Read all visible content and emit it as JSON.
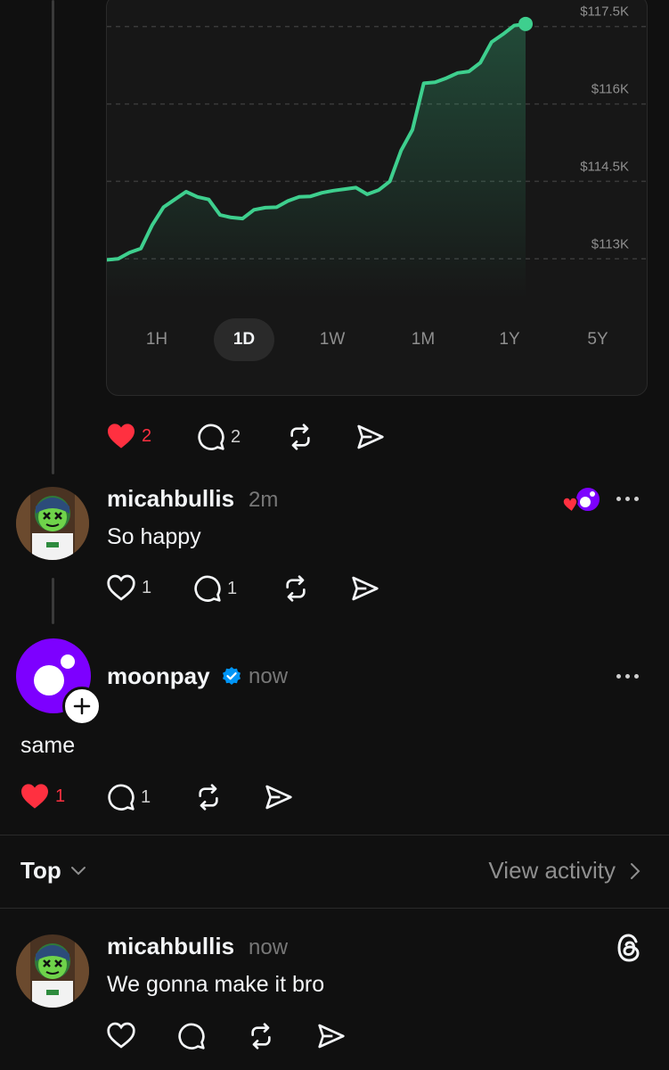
{
  "chart_data": {
    "type": "area",
    "y_ticks": [
      "$117.5K",
      "$116K",
      "$114.5K",
      "$113K"
    ],
    "y_tick_values": [
      117500,
      116000,
      114500,
      113000
    ],
    "ylim": [
      112400,
      118100
    ],
    "grid": true,
    "series_color": "#3ecf8e",
    "values": [
      112980,
      113000,
      113120,
      113200,
      113650,
      114000,
      114150,
      114300,
      114200,
      114150,
      113850,
      113800,
      113780,
      113950,
      113990,
      114000,
      114120,
      114200,
      114210,
      114280,
      114320,
      114350,
      114380,
      114250,
      114330,
      114500,
      115100,
      115500,
      116400,
      116420,
      116500,
      116600,
      116630,
      116800,
      117200,
      117350,
      117520,
      117550
    ]
  },
  "ranges": [
    {
      "label": "1H",
      "active": false
    },
    {
      "label": "1D",
      "active": true
    },
    {
      "label": "1W",
      "active": false
    },
    {
      "label": "1M",
      "active": false
    },
    {
      "label": "1Y",
      "active": false
    },
    {
      "label": "5Y",
      "active": false
    }
  ],
  "post_main": {
    "likes": "2",
    "replies": "2"
  },
  "reply1": {
    "username": "micahbullis",
    "time": "2m",
    "text": "So happy",
    "likes": "1",
    "replies": "1"
  },
  "reply2": {
    "username": "moonpay",
    "time": "now",
    "text": "same",
    "likes": "1",
    "replies": "1"
  },
  "sort": {
    "label": "Top",
    "view_activity": "View activity"
  },
  "reply3": {
    "username": "micahbullis",
    "time": "now",
    "text": "We gonna make it bro"
  },
  "colors": {
    "background": "#101010",
    "like_red": "#ff3040",
    "verified_blue": "#0095f6",
    "moonpay_purple": "#7d00ff",
    "chart_green": "#3ecf8e"
  },
  "icons": [
    "heart-icon",
    "comment-icon",
    "repost-icon",
    "share-icon",
    "more-icon",
    "verified-icon",
    "threads-logo-icon",
    "chevron-down-icon",
    "chevron-right-icon",
    "follow-plus-icon"
  ]
}
